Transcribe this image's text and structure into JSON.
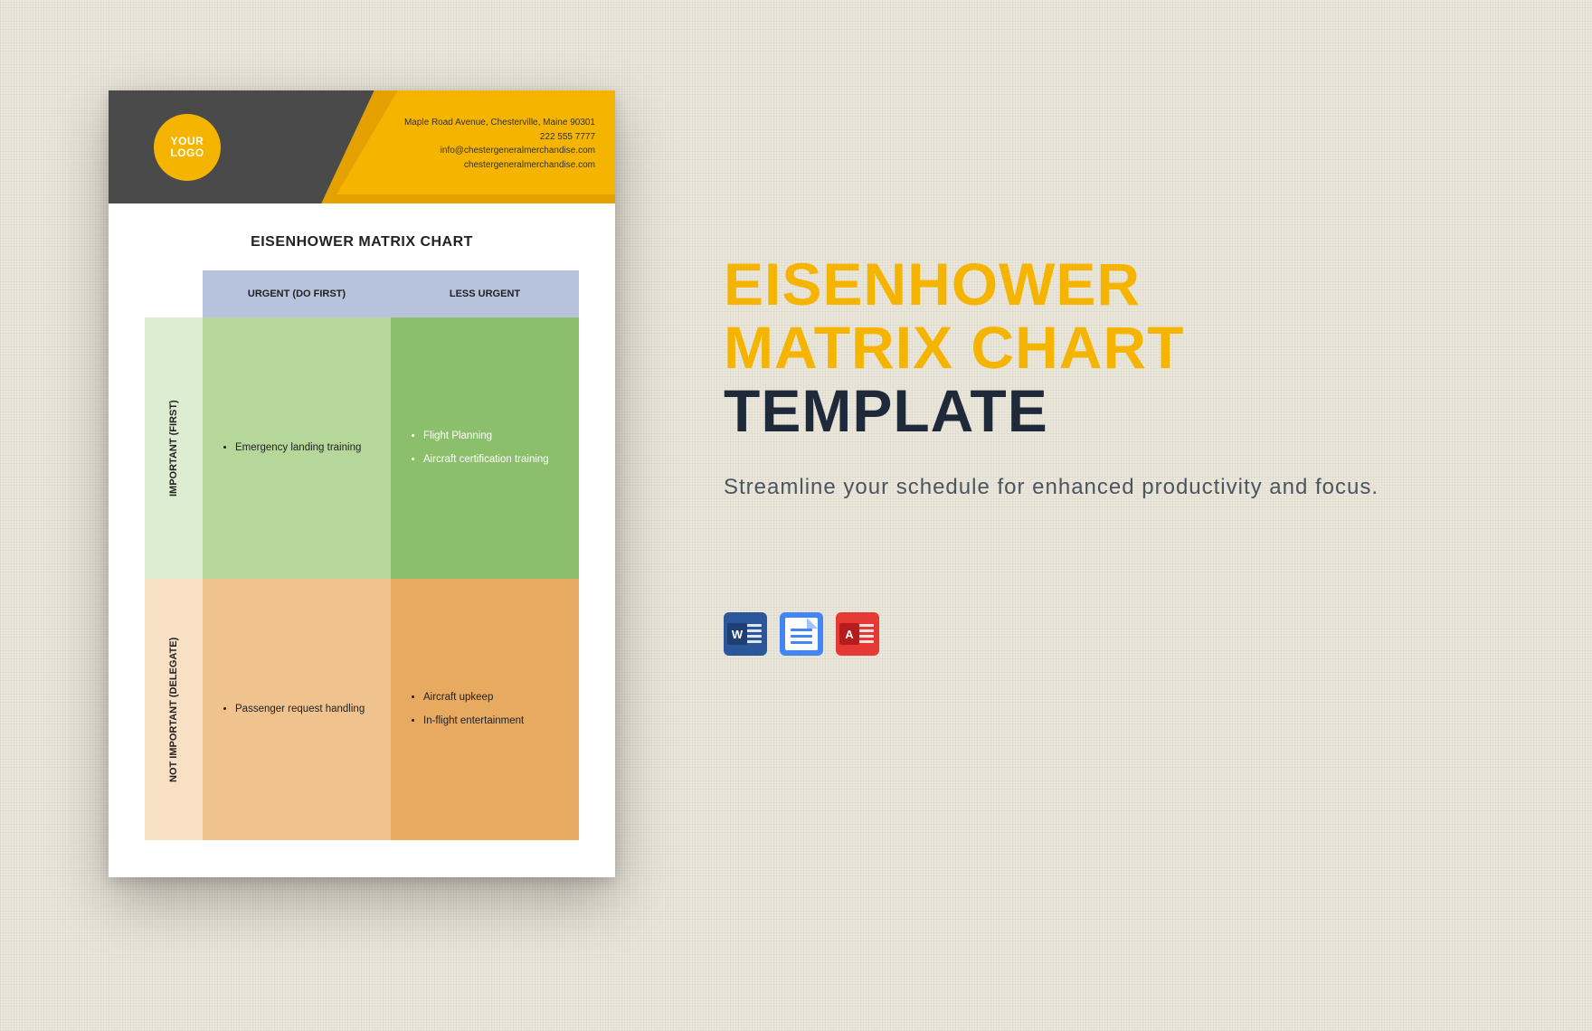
{
  "document": {
    "logo": {
      "line1": "YOUR",
      "line2": "LOGO"
    },
    "header_info": {
      "address": "Maple Road Avenue, Chesterville, Maine 90301",
      "phone": "222 555 7777",
      "email": "info@chestergeneralmerchandise.com",
      "website": "chestergeneralmerchandise.com"
    },
    "title": "EISENHOWER MATRIX CHART",
    "matrix": {
      "col_headers": [
        "URGENT (DO FIRST)",
        "LESS URGENT"
      ],
      "row_headers": [
        "IMPORTANT (FIRST)",
        "NOT IMPORTANT (DELEGATE)"
      ],
      "cells": {
        "r1c1": [
          "Emergency landing training"
        ],
        "r1c2": [
          "Flight Planning",
          "Aircraft certification training"
        ],
        "r2c1": [
          "Passenger request handling"
        ],
        "r2c2": [
          "Aircraft upkeep",
          "In-flight entertainment"
        ]
      }
    }
  },
  "promo": {
    "title_line1": "EISENHOWER",
    "title_line2": "MATRIX CHART",
    "title_line3": "TEMPLATE",
    "subtitle": "Streamline your schedule for enhanced productivity and focus."
  },
  "formats": {
    "word_badge": "W",
    "pdf_badge": "A",
    "word_name": "Word",
    "gdoc_name": "Google Docs",
    "pdf_name": "PDF"
  },
  "colors": {
    "accent": "#f5b400",
    "dark": "#1e2a3a"
  }
}
